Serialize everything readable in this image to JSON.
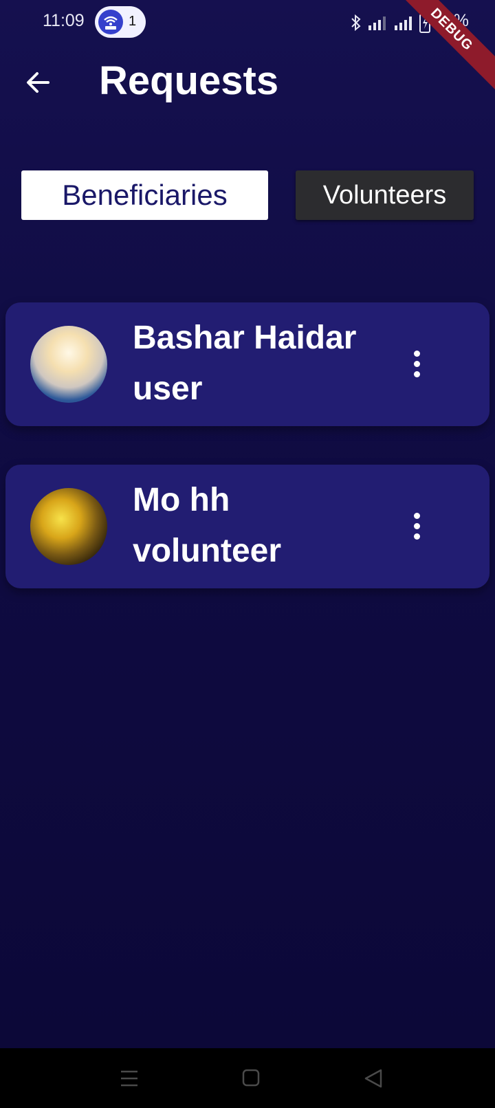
{
  "status_bar": {
    "time": "11:09",
    "hotspot_count": "1",
    "battery": "87%"
  },
  "debug_banner": "DEBUG",
  "app_bar": {
    "title": "Requests",
    "back_icon": "arrow-left-icon"
  },
  "tabs": [
    {
      "label": "Beneficiaries",
      "active": true
    },
    {
      "label": "Volunteers",
      "active": false
    }
  ],
  "requests": [
    {
      "name": "Bashar Haidar",
      "role": "user",
      "menu_icon": "more-vert-icon"
    },
    {
      "name": "Mo hh",
      "role": "volunteer",
      "menu_icon": "more-vert-icon"
    }
  ],
  "nav_bar": {
    "icons": [
      "menu-icon",
      "home-icon",
      "back-triangle-icon"
    ]
  },
  "colors": {
    "background": "#100c44",
    "card": "#221d72",
    "tab_active_bg": "#ffffff",
    "tab_active_text": "#1a1868",
    "tab_inactive_bg": "#2c2c2f",
    "debug_ribbon": "#8e1b2b"
  }
}
